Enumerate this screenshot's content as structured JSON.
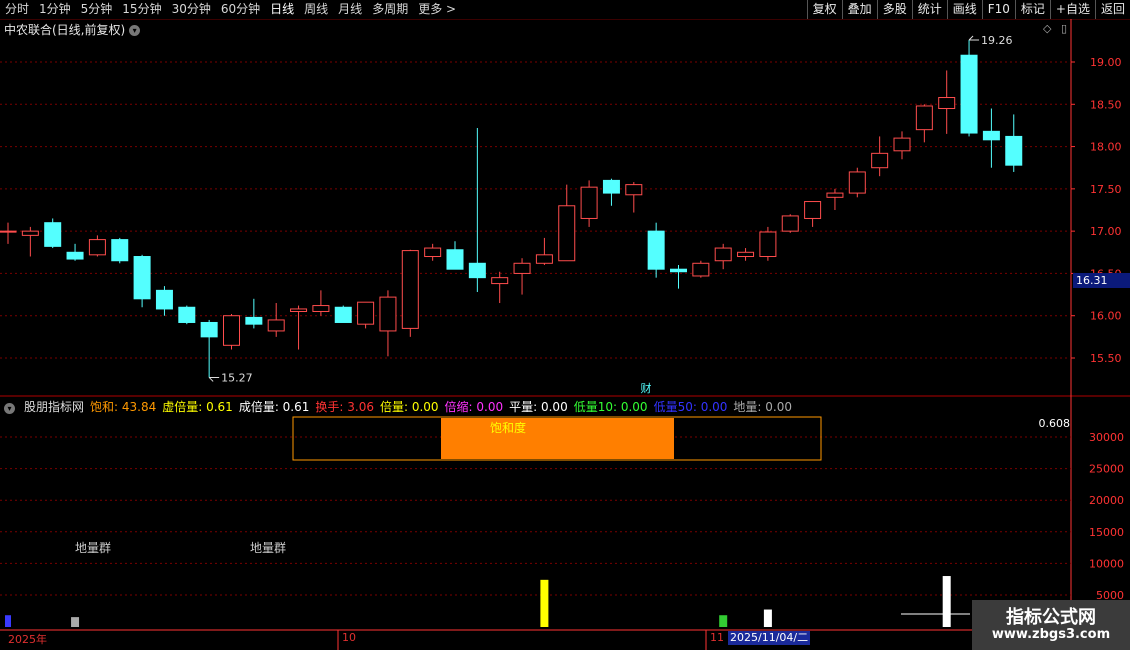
{
  "toolbar": {
    "periods": [
      "分时",
      "1分钟",
      "5分钟",
      "15分钟",
      "30分钟",
      "60分钟",
      "日线",
      "周线",
      "月线",
      "多周期",
      "更多 >"
    ],
    "active_period": "日线",
    "right_buttons": [
      "复权",
      "叠加",
      "多股",
      "统计",
      "画线",
      "F10",
      "标记",
      "+自选",
      "返回"
    ]
  },
  "stock": {
    "title": "中农联合(日线,前复权)",
    "current_price": "16.31",
    "high_label": "19.26",
    "low_label": "15.27",
    "event_marker": "财"
  },
  "indicator": {
    "name": "股朋指标网",
    "items": [
      {
        "label": "饱和:",
        "value": "43.84",
        "color": "#ff9900"
      },
      {
        "label": "虚倍量:",
        "value": "0.61",
        "color": "#ffff00"
      },
      {
        "label": "成倍量:",
        "value": "0.61",
        "color": "#ffffff"
      },
      {
        "label": "换手:",
        "value": "3.06",
        "color": "#ff3333"
      },
      {
        "label": "倍量:",
        "value": "0.00",
        "color": "#ffff00"
      },
      {
        "label": "倍缩:",
        "value": "0.00",
        "color": "#ff33ff"
      },
      {
        "label": "平量:",
        "value": "0.00",
        "color": "#ffffff"
      },
      {
        "label": "低量10:",
        "value": "0.00",
        "color": "#33ff33"
      },
      {
        "label": "低量50:",
        "value": "0.00",
        "color": "#3333ff"
      },
      {
        "label": "地量:",
        "value": "0.00",
        "color": "#aaaaaa"
      }
    ],
    "box_label": "饱和度",
    "box_value": "0.608",
    "ground_labels": [
      "地量群",
      "地量群"
    ]
  },
  "time_axis": {
    "year": "2025年",
    "oct": "10",
    "nov": "11",
    "cursor_date": "2025/11/04/二"
  },
  "watermark": {
    "line1": "指标公式网",
    "line2": "www.zbgs3.com"
  },
  "colors": {
    "up": "#ff4d4d",
    "down": "#54ffff",
    "grid": "#7a0000",
    "axis": "#ff3333"
  },
  "chart_data": {
    "type": "candlestick",
    "price_axis": {
      "ticks": [
        15.5,
        16.0,
        16.5,
        17.0,
        17.5,
        18.0,
        18.5,
        19.0
      ]
    },
    "volume_axis": {
      "ticks": [
        5000,
        10000,
        15000,
        20000,
        25000,
        30000
      ]
    },
    "candles": [
      [
        17.0,
        17.1,
        16.85,
        17.0
      ],
      [
        16.95,
        17.05,
        16.7,
        17.0
      ],
      [
        17.1,
        17.15,
        16.8,
        16.82
      ],
      [
        16.75,
        16.85,
        16.65,
        16.67
      ],
      [
        16.72,
        16.95,
        16.7,
        16.9
      ],
      [
        16.9,
        16.92,
        16.62,
        16.65
      ],
      [
        16.7,
        16.72,
        16.1,
        16.2
      ],
      [
        16.3,
        16.35,
        16.0,
        16.08
      ],
      [
        16.1,
        16.12,
        15.9,
        15.92
      ],
      [
        15.92,
        15.95,
        15.27,
        15.75
      ],
      [
        15.65,
        16.02,
        15.6,
        16.0
      ],
      [
        15.98,
        16.2,
        15.85,
        15.9
      ],
      [
        15.82,
        16.15,
        15.75,
        15.95
      ],
      [
        16.05,
        16.12,
        15.6,
        16.08
      ],
      [
        16.05,
        16.3,
        16.0,
        16.12
      ],
      [
        16.1,
        16.12,
        15.95,
        15.92
      ],
      [
        15.9,
        16.15,
        15.85,
        16.16
      ],
      [
        15.82,
        16.3,
        15.52,
        16.22
      ],
      [
        15.85,
        16.78,
        15.75,
        16.77
      ],
      [
        16.7,
        16.85,
        16.65,
        16.8
      ],
      [
        16.78,
        16.88,
        16.55,
        16.55
      ],
      [
        16.62,
        18.22,
        16.28,
        16.45
      ],
      [
        16.38,
        16.52,
        16.15,
        16.45
      ],
      [
        16.5,
        16.68,
        16.25,
        16.62
      ],
      [
        16.62,
        16.92,
        16.6,
        16.72
      ],
      [
        16.65,
        17.55,
        16.65,
        17.3
      ],
      [
        17.15,
        17.6,
        17.05,
        17.52
      ],
      [
        17.6,
        17.62,
        17.3,
        17.45
      ],
      [
        17.43,
        17.58,
        17.22,
        17.55
      ],
      [
        17.0,
        17.1,
        16.45,
        16.55
      ],
      [
        16.55,
        16.6,
        16.32,
        16.52
      ],
      [
        16.47,
        16.65,
        16.45,
        16.62
      ],
      [
        16.65,
        16.85,
        16.55,
        16.8
      ],
      [
        16.7,
        16.8,
        16.65,
        16.75
      ],
      [
        16.7,
        17.05,
        16.65,
        16.99
      ],
      [
        17.0,
        17.2,
        16.98,
        17.18
      ],
      [
        17.15,
        17.35,
        17.05,
        17.35
      ],
      [
        17.4,
        17.5,
        17.25,
        17.45
      ],
      [
        17.45,
        17.75,
        17.4,
        17.7
      ],
      [
        17.75,
        18.12,
        17.65,
        17.92
      ],
      [
        17.95,
        18.18,
        17.85,
        18.1
      ],
      [
        18.2,
        18.5,
        18.05,
        18.48
      ],
      [
        18.45,
        18.9,
        18.15,
        18.58
      ],
      [
        19.08,
        19.26,
        18.12,
        18.16
      ],
      [
        18.18,
        18.45,
        17.75,
        18.08
      ],
      [
        18.12,
        18.38,
        17.7,
        17.78
      ]
    ],
    "volume_bars": [
      {
        "index": 0,
        "value": 1800,
        "color": "#3a3aff"
      },
      {
        "index": 3,
        "value": 1500,
        "color": "#aaaaaa"
      },
      {
        "index": 24,
        "value": 7400,
        "color": "#ffff00"
      },
      {
        "index": 32,
        "value": 1800,
        "color": "#33cc33"
      },
      {
        "index": 34,
        "value": 2700,
        "color": "#ffffff"
      },
      {
        "index": 42,
        "value": 8000,
        "color": "#ffffff"
      }
    ]
  }
}
